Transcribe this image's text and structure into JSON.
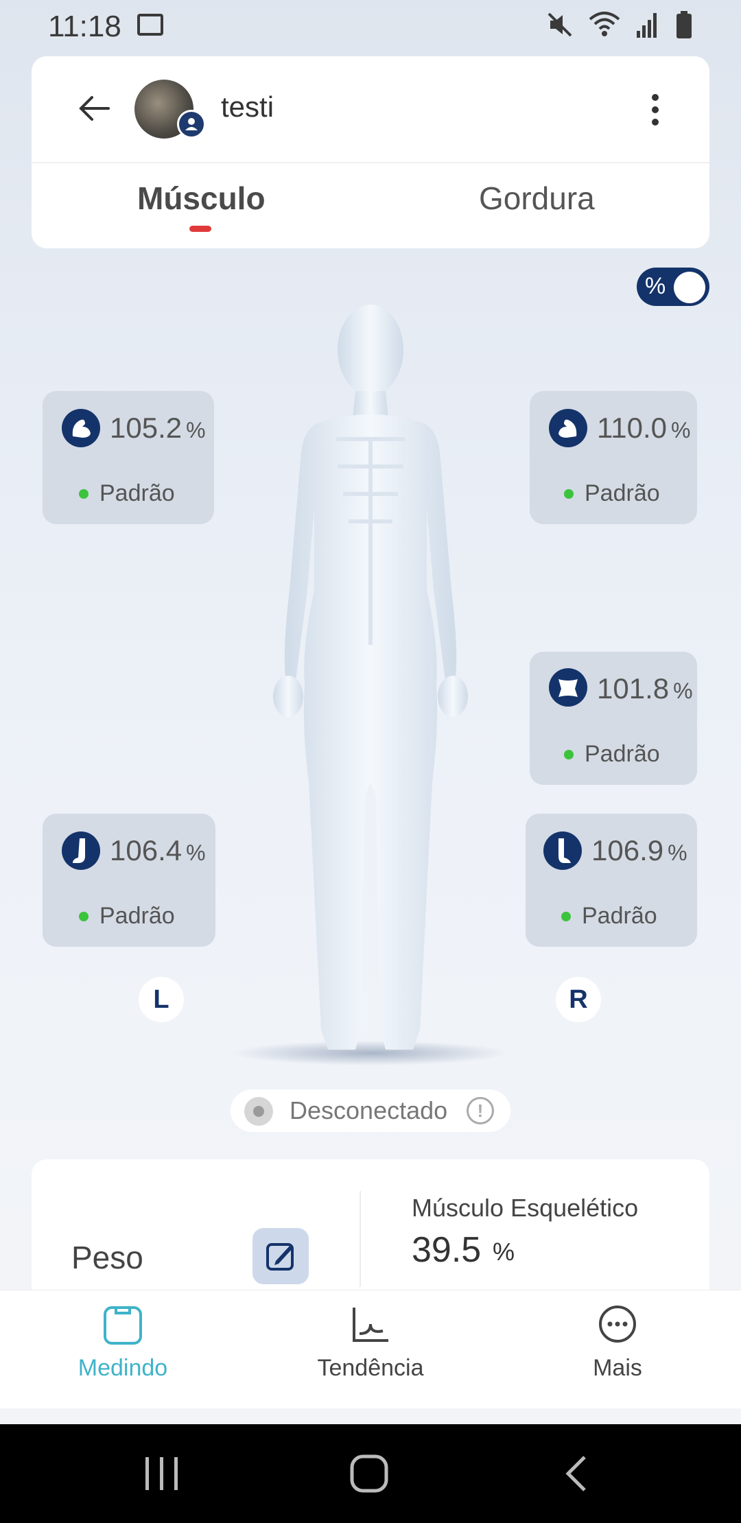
{
  "status_bar": {
    "time": "11:18"
  },
  "header": {
    "username": "testi"
  },
  "tabs": [
    {
      "label": "Músculo",
      "active": true
    },
    {
      "label": "Gordura",
      "active": false
    }
  ],
  "toggle": {
    "label": "%",
    "on": true
  },
  "segments": {
    "left_arm": {
      "value": "105.2",
      "unit": "%",
      "status": "Padrão",
      "icon": "arm-icon"
    },
    "right_arm": {
      "value": "110.0",
      "unit": "%",
      "status": "Padrão",
      "icon": "arm-icon"
    },
    "trunk": {
      "value": "101.8",
      "unit": "%",
      "status": "Padrão",
      "icon": "trunk-icon"
    },
    "left_leg": {
      "value": "106.4",
      "unit": "%",
      "status": "Padrão",
      "icon": "leg-icon"
    },
    "right_leg": {
      "value": "106.9",
      "unit": "%",
      "status": "Padrão",
      "icon": "leg-icon"
    }
  },
  "side_markers": {
    "left": "L",
    "right": "R"
  },
  "connection": {
    "status": "Desconectado"
  },
  "summary": {
    "weight_label": "Peso",
    "muscle_label": "Músculo Esquelético",
    "muscle_value": "39.5",
    "muscle_unit": "%"
  },
  "bottom_nav": [
    {
      "label": "Medindo",
      "active": true,
      "icon": "scale-icon"
    },
    {
      "label": "Tendência",
      "active": false,
      "icon": "trend-icon"
    },
    {
      "label": "Mais",
      "active": false,
      "icon": "more-icon"
    }
  ],
  "colors": {
    "accent": "#3fb3c9",
    "primary_dark": "#14336a",
    "status_green": "#3cc33c",
    "tab_indicator": "#e03a3a"
  }
}
